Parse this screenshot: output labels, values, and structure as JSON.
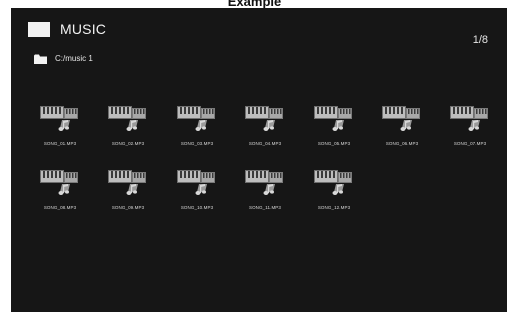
{
  "caption": "Example",
  "header": {
    "icon": "window-icon",
    "title": "MUSIC",
    "page_indicator": "1/8"
  },
  "path": {
    "icon": "folder-icon",
    "text": "C:/music 1"
  },
  "files": [
    {
      "name": "SONG_01.MP3",
      "icon": "music-file-icon"
    },
    {
      "name": "SONG_02.MP3",
      "icon": "music-file-icon"
    },
    {
      "name": "SONG_03.MP3",
      "icon": "music-file-icon"
    },
    {
      "name": "SONG_04.MP3",
      "icon": "music-file-icon"
    },
    {
      "name": "SONG_05.MP3",
      "icon": "music-file-icon"
    },
    {
      "name": "SONG_06.MP3",
      "icon": "music-file-icon"
    },
    {
      "name": "SONG_07.MP3",
      "icon": "music-file-icon"
    },
    {
      "name": "SONG_08.MP3",
      "icon": "music-file-icon"
    },
    {
      "name": "SONG_09.MP3",
      "icon": "music-file-icon"
    },
    {
      "name": "SONG_10.MP3",
      "icon": "music-file-icon"
    },
    {
      "name": "SONG_11.MP3",
      "icon": "music-file-icon"
    },
    {
      "name": "SONG_12.MP3",
      "icon": "music-file-icon"
    }
  ],
  "colors": {
    "screen_bg": "#161616",
    "text": "#e6e6e6"
  }
}
